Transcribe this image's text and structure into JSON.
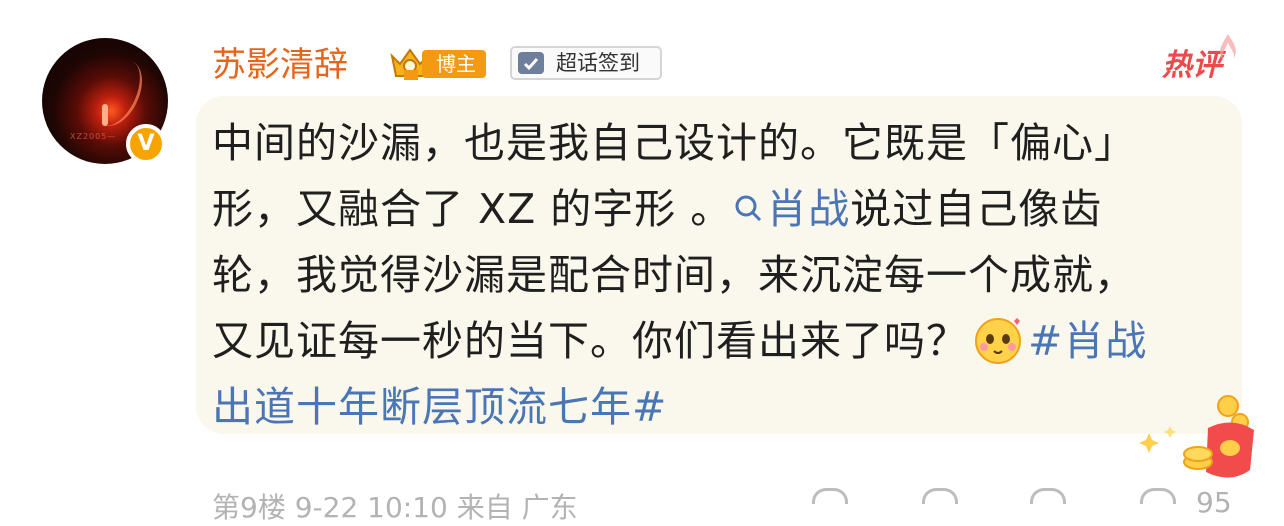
{
  "comment": {
    "username": "苏影清辞",
    "verified_badge": "V",
    "badges": {
      "blogger": "博主",
      "checkin": "超话签到"
    },
    "hot_label": "热评",
    "lines": {
      "l1": "中间的沙漏，也是我自己设计的。它既是「偏心」",
      "l2_a": "形，又融合了 XZ 的字形 。",
      "l2_link": "肖战",
      "l2_b": "说过自己像齿",
      "l3": "轮，我觉得沙漏是配合时间，来沉淀每一个成就，",
      "l4_a": "又见证每一秒的当下。你们看出来了吗？",
      "l4_tag": "#肖战",
      "l5_tag": "出道十年断层顶流七年#"
    },
    "footer": {
      "meta": "第9楼  9-22 10:10  来自 广东",
      "like_count": "95"
    },
    "icons": {
      "search": "search-icon",
      "emoji": "blushing-emoji-icon",
      "crown": "crown-icon",
      "checkin": "calendar-check-icon"
    },
    "colors": {
      "username": "#e4651b",
      "link": "#4a76b6",
      "hot": "#f0484b",
      "bubble": "#faf7ec"
    }
  }
}
